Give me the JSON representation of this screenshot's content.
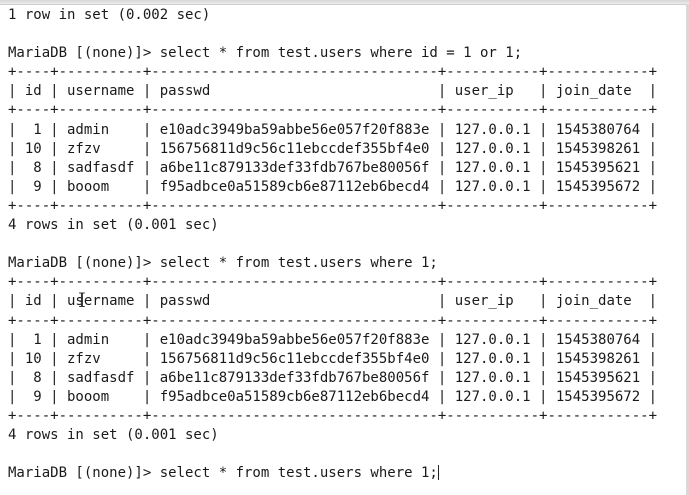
{
  "terminal": {
    "lines": [
      "1 row in set (0.002 sec)",
      "",
      "MariaDB [(none)]> select * from test.users where id = 1 or 1;",
      "+----+----------+----------------------------------+-----------+------------+",
      "| id | username | passwd                           | user_ip   | join_date  |",
      "+----+----------+----------------------------------+-----------+------------+",
      "|  1 | admin    | e10adc3949ba59abbe56e057f20f883e | 127.0.0.1 | 1545380764 |",
      "| 10 | zfzv     | 156756811d9c56c11ebccdef355bf4e0 | 127.0.0.1 | 1545398261 |",
      "|  8 | sadfasdf | a6be11c879133def33fdb767be80056f | 127.0.0.1 | 1545395621 |",
      "|  9 | booom    | f95adbce0a51589cb6e87112eb6becd4 | 127.0.0.1 | 1545395672 |",
      "+----+----------+----------------------------------+-----------+------------+",
      "4 rows in set (0.001 sec)",
      "",
      "MariaDB [(none)]> select * from test.users where 1;",
      "+----+----------+----------------------------------+-----------+------------+",
      "| id | username | passwd                           | user_ip   | join_date  |",
      "+----+----------+----------------------------------+-----------+------------+",
      "|  1 | admin    | e10adc3949ba59abbe56e057f20f883e | 127.0.0.1 | 1545380764 |",
      "| 10 | zfzv     | 156756811d9c56c11ebccdef355bf4e0 | 127.0.0.1 | 1545398261 |",
      "|  8 | sadfasdf | a6be11c879133def33fdb767be80056f | 127.0.0.1 | 1545395621 |",
      "|  9 | booom    | f95adbce0a51589cb6e87112eb6becd4 | 127.0.0.1 | 1545395672 |",
      "+----+----------+----------------------------------+-----------+------------+",
      "4 rows in set (0.001 sec)",
      "",
      "MariaDB [(none)]> select * from test.users where 1;"
    ]
  }
}
